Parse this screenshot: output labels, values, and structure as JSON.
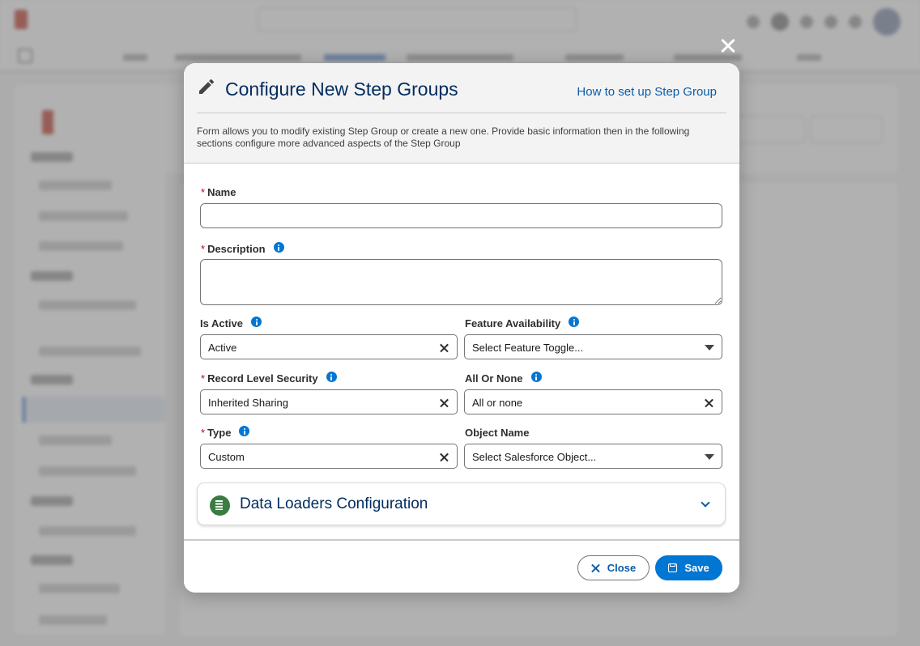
{
  "modal": {
    "title": "Configure New Step Groups",
    "help_link": "How to set up Step Group",
    "description": "Form allows you to modify existing Step Group or create a new one. Provide basic information then in the following sections configure more advanced aspects of the Step Group"
  },
  "fields": {
    "name": {
      "label": "Name",
      "required": "*",
      "value": ""
    },
    "description": {
      "label": "Description",
      "required": "*",
      "value": ""
    },
    "is_active": {
      "label": "Is Active",
      "value": "Active"
    },
    "feature_availability": {
      "label": "Feature Availability",
      "placeholder": "Select Feature Toggle..."
    },
    "record_level_security": {
      "label": "Record Level Security",
      "required": "*",
      "value": "Inherited Sharing"
    },
    "all_or_none": {
      "label": "All Or None",
      "value": "All or none"
    },
    "type": {
      "label": "Type",
      "required": "*",
      "value": "Custom"
    },
    "object_name": {
      "label": "Object Name",
      "placeholder": "Select Salesforce Object..."
    }
  },
  "accordion": {
    "title": "Data Loaders Configuration"
  },
  "footer": {
    "close_label": "Close",
    "save_label": "Save"
  },
  "colors": {
    "brand": "#0176d3",
    "title": "#032d60",
    "link": "#0b5cab",
    "required": "#ba0517"
  },
  "icons": {
    "header": "pencil-icon",
    "info": "info-icon",
    "clear": "clear-icon",
    "dropdown": "caret-down-icon",
    "accordion": "data-loader-icon",
    "expand": "chevron-down-icon",
    "close_modal": "close-icon",
    "save": "save-icon"
  }
}
